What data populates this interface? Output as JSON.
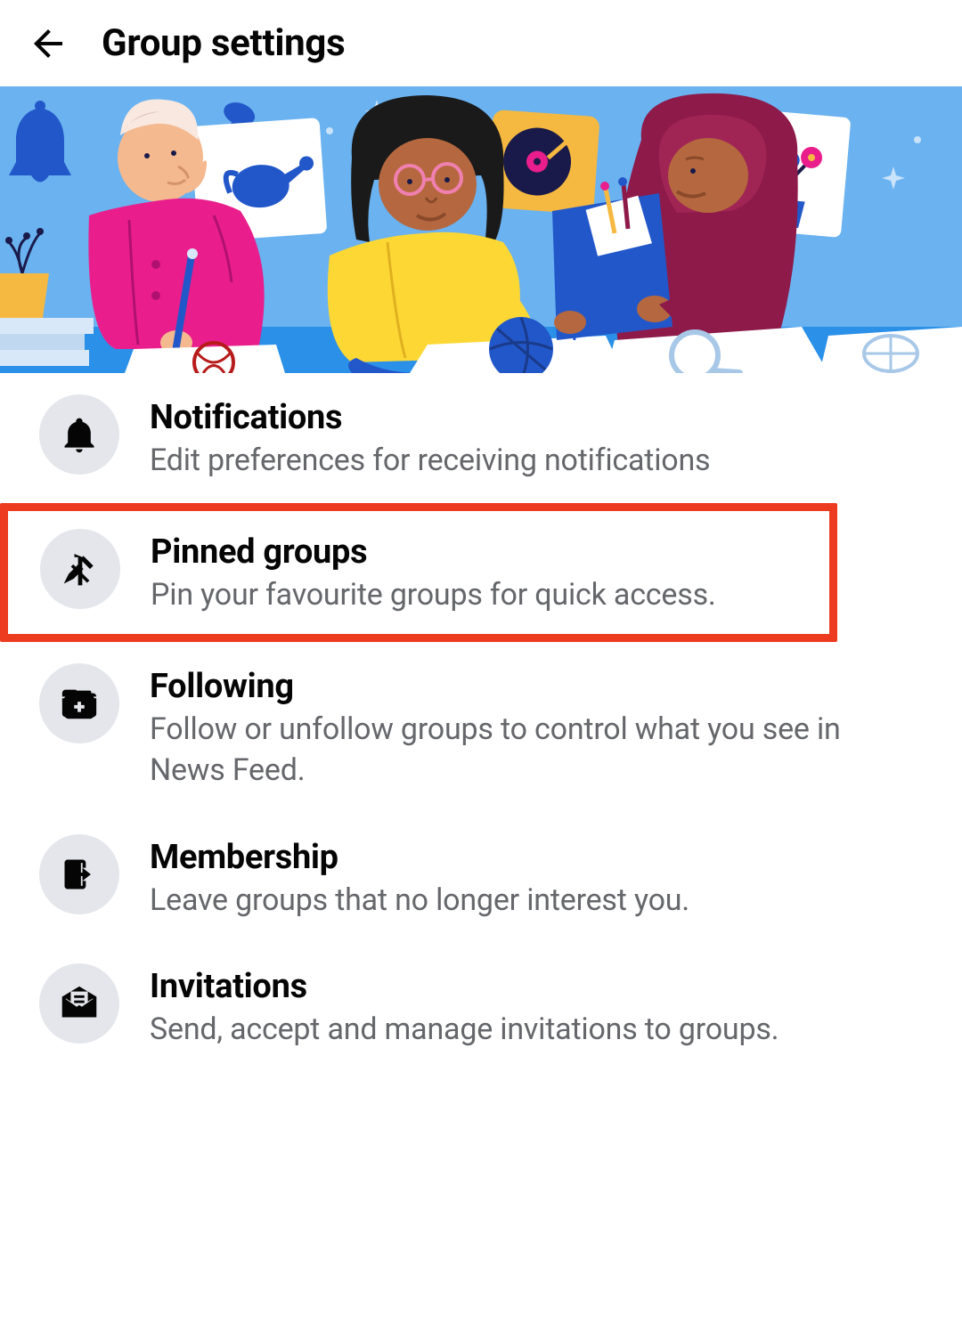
{
  "header": {
    "title": "Group settings"
  },
  "items": [
    {
      "title": "Notifications",
      "subtitle": "Edit preferences for receiving notifications"
    },
    {
      "title": "Pinned groups",
      "subtitle": "Pin your favourite groups for quick access."
    },
    {
      "title": "Following",
      "subtitle": "Follow or unfollow groups to control what you see in News Feed."
    },
    {
      "title": "Membership",
      "subtitle": "Leave groups that no longer interest you."
    },
    {
      "title": "Invitations",
      "subtitle": "Send, accept and manage invitations to groups."
    }
  ]
}
